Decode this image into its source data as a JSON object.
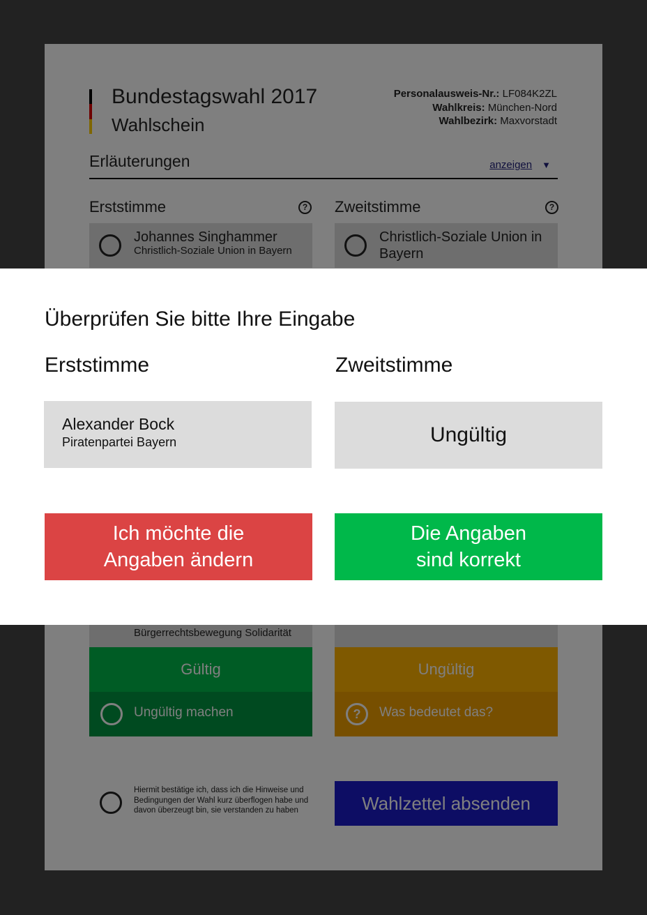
{
  "ballot": {
    "title": "Bundestagswahl 2017",
    "subtitle": "Wahlschein",
    "flag_colors": [
      "#000000",
      "#dd0000",
      "#ffcc00"
    ],
    "id_label": "Personalausweis-Nr.:",
    "id_value": "LF084K2ZL",
    "district_label": "Wahlkreis:",
    "district_value": "München-Nord",
    "precinct_label": "Wahlbezirk:",
    "precinct_value": "Maxvorstadt",
    "explanations_label": "Erläuterungen",
    "explanations_toggle": "anzeigen",
    "first_vote_heading": "Erststimme",
    "second_vote_heading": "Zweitstimme",
    "first_candidate": {
      "name": "Johannes Singhammer",
      "party": "Christlich-Soziale Union in Bayern"
    },
    "second_candidate": {
      "name": "Christlich-Soziale Union in Bayern"
    },
    "lower_first_party": "Bürgerrechtsbewegung Solidarität",
    "first_status": "Gültig",
    "second_status": "Ungültig",
    "first_action": "Ungültig machen",
    "second_action": "Was bedeutet das?",
    "confirm_text": "Hiermit bestätige ich, dass ich die Hinweise und Bedingungen der Wahl kurz überflogen habe und davon überzeugt bin, sie verstanden zu haben",
    "submit_label": "Wahlzettel absenden",
    "colors": {
      "valid": "#00b84a",
      "valid_dark": "#009440",
      "invalid": "#ffb300",
      "invalid_dark": "#ee9f00",
      "submit": "#1a1ac8"
    }
  },
  "modal": {
    "title": "Überprüfen Sie bitte Ihre Eingabe",
    "first_heading": "Erststimme",
    "second_heading": "Zweitstimme",
    "first_choice": {
      "name": "Alexander Bock",
      "party": "Piratenpartei Bayern"
    },
    "second_choice": "Ungültig",
    "change_button": {
      "line1": "Ich möchte die",
      "line2": "Angaben ändern"
    },
    "confirm_button": {
      "line1": "Die Angaben",
      "line2": "sind korrekt"
    },
    "colors": {
      "change": "#db4444",
      "confirm": "#00b84a"
    }
  }
}
